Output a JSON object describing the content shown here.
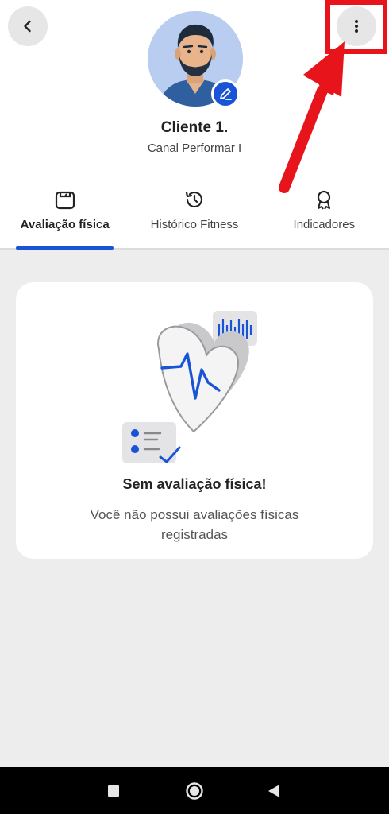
{
  "profile": {
    "name": "Cliente 1.",
    "subtitle": "Canal Performar I"
  },
  "tabs": [
    {
      "label": "Avaliação física",
      "icon": "scale-icon",
      "active": true
    },
    {
      "label": "Histórico Fitness",
      "icon": "history-icon",
      "active": false
    },
    {
      "label": "Indicadores",
      "icon": "award-icon",
      "active": false
    }
  ],
  "empty_state": {
    "title": "Sem avaliação física!",
    "description": "Você não possui avaliações físicas registradas"
  },
  "colors": {
    "accent": "#1a54d6",
    "annotation": "#e8141b",
    "background": "#ededed"
  }
}
